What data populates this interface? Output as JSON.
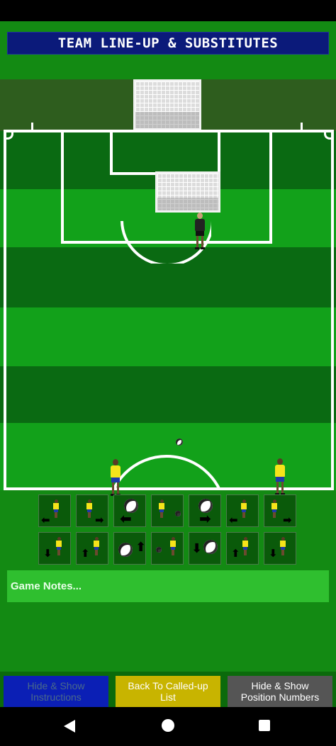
{
  "header": {
    "title": "TEAM LINE-UP & SUBSTITUTES"
  },
  "pitch": {
    "colors": {
      "stripe_dark": "#0a6a12",
      "stripe_light": "#12a11a",
      "lines": "#ffffff",
      "jersey": "#f5e41a",
      "shorts": "#1e3aa8"
    },
    "players": [
      "goalkeeper",
      "player-left",
      "player-right"
    ],
    "ball": "soccer-ball"
  },
  "controls": {
    "row1": [
      "move-left-icon",
      "move-right-icon",
      "ball-left-icon",
      "ball-small-icon",
      "ball-right-icon",
      "move-left-icon",
      "move-right-icon"
    ],
    "row2": [
      "move-down-icon",
      "move-up-icon",
      "ball-up-icon",
      "ball-small-icon",
      "ball-down-icon",
      "move-up-icon",
      "move-down-icon"
    ]
  },
  "notes": {
    "placeholder": "Game Notes..."
  },
  "buttons": {
    "instructions": {
      "label": "Hide & Show\nInstructions",
      "bg": "#0b1fb5",
      "color": "#4a6a8a"
    },
    "back": {
      "label": "Back To Called-up\nList",
      "bg": "#c8b400",
      "color": "#ffffff"
    },
    "position_numbers": {
      "label": "Hide & Show\nPosition Numbers",
      "bg": "#555555",
      "color": "#ffffff"
    }
  },
  "navigation": {
    "back": "back-icon",
    "home": "home-icon",
    "recent": "recent-apps-icon"
  }
}
